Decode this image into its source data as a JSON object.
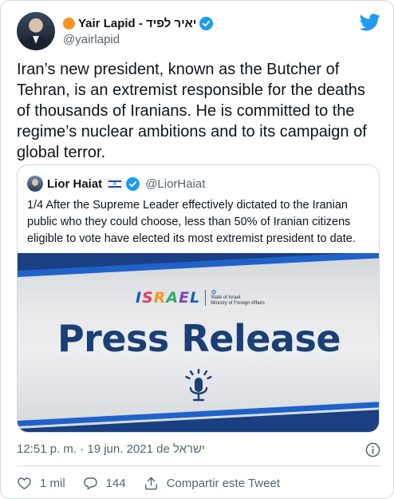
{
  "author": {
    "display_name": "Yair Lapid - יאיר לפיד",
    "handle": "@yairlapid"
  },
  "tweet": {
    "text": "Iran’s new president, known as the Butcher of Tehran, is an extremist responsible for the deaths of thousands of Iranians. He is committed to the regime’s nuclear ambitions and to its campaign of global terror.",
    "timestamp": "12:51 p. m. · 19 jun. 2021 de ישראל"
  },
  "quoted": {
    "display_name": "Lior Haiat",
    "handle": "@LiorHaiat",
    "text": "1/4 After the Supreme Leader effectively dictated to the Iranian public who they could choose, less than 50% of Iranian citizens eligible to vote have elected its most extremist president to date.",
    "image": {
      "brand_letters": [
        "I",
        "S",
        "R",
        "A",
        "E",
        "L"
      ],
      "ministry_line1": "State of Israel",
      "ministry_line2": "Ministry of Foreign Affairs",
      "title": "Press Release"
    }
  },
  "actions": {
    "likes": "1 mil",
    "replies": "144",
    "share_label": "Compartir este Tweet"
  },
  "colors": {
    "accent": "#1d9bf0",
    "muted": "#536471",
    "press_blue": "#1b3f75"
  },
  "icons": {
    "verified": "verified-badge-icon",
    "bird": "twitter-bird-icon",
    "info": "info-icon",
    "like": "heart-icon",
    "reply": "reply-bubble-icon",
    "share": "share-icon",
    "mic": "microphone-icon"
  }
}
